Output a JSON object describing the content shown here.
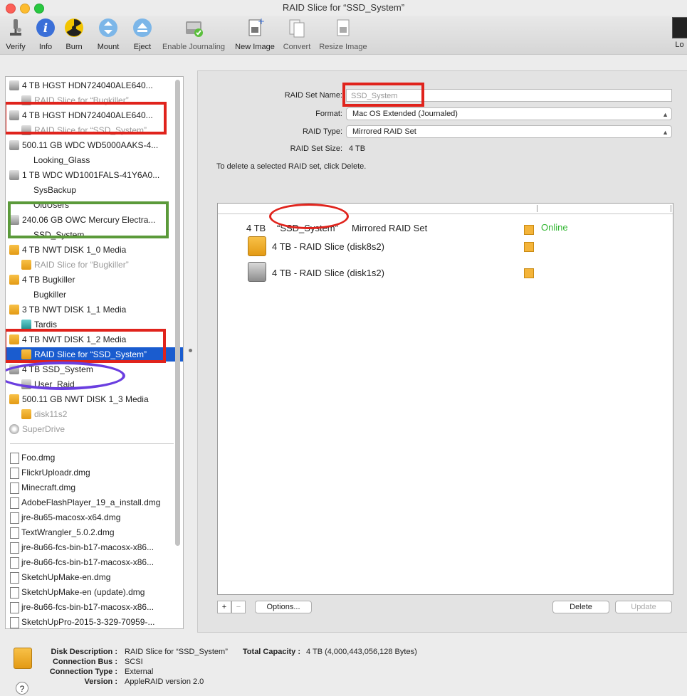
{
  "window": {
    "title": "RAID Slice for “SSD_System”"
  },
  "toolbar": {
    "items": [
      {
        "label": "Verify"
      },
      {
        "label": "Info"
      },
      {
        "label": "Burn"
      },
      {
        "label": "Mount"
      },
      {
        "label": "Eject"
      },
      {
        "label": "Enable Journaling"
      },
      {
        "label": "New Image"
      },
      {
        "label": "Convert"
      },
      {
        "label": "Resize Image"
      }
    ],
    "log_label": "Lo"
  },
  "sidebar": {
    "items": [
      {
        "label": "4 TB HGST HDN724040ALE640..."
      },
      {
        "label": "RAID Slice for “Bugkiller”"
      },
      {
        "label": "4 TB HGST HDN724040ALE640..."
      },
      {
        "label": "RAID Slice for “SSD_System”"
      },
      {
        "label": "500.11 GB WDC WD5000AAKS-4..."
      },
      {
        "label": "Looking_Glass"
      },
      {
        "label": "1 TB WDC WD1001FALS-41Y6A0..."
      },
      {
        "label": "SysBackup"
      },
      {
        "label": "OldUsers"
      },
      {
        "label": "240.06 GB OWC Mercury Electra..."
      },
      {
        "label": "SSD_System"
      },
      {
        "label": "4 TB NWT DISK 1_0 Media"
      },
      {
        "label": "RAID Slice for “Bugkiller”"
      },
      {
        "label": "4 TB Bugkiller"
      },
      {
        "label": "Bugkiller"
      },
      {
        "label": "3 TB NWT DISK 1_1 Media"
      },
      {
        "label": "Tardis"
      },
      {
        "label": "4 TB NWT DISK 1_2 Media"
      },
      {
        "label": "RAID Slice for “SSD_System”"
      },
      {
        "label": "4 TB SSD_System"
      },
      {
        "label": "User_Raid"
      },
      {
        "label": "500.11 GB NWT DISK 1_3 Media"
      },
      {
        "label": "disk11s2"
      },
      {
        "label": "SuperDrive"
      }
    ],
    "images": [
      {
        "label": "Foo.dmg"
      },
      {
        "label": "FlickrUploadr.dmg"
      },
      {
        "label": "Minecraft.dmg"
      },
      {
        "label": "AdobeFlashPlayer_19_a_install.dmg"
      },
      {
        "label": "jre-8u65-macosx-x64.dmg"
      },
      {
        "label": "TextWrangler_5.0.2.dmg"
      },
      {
        "label": "jre-8u66-fcs-bin-b17-macosx-x86..."
      },
      {
        "label": "jre-8u66-fcs-bin-b17-macosx-x86..."
      },
      {
        "label": "SketchUpMake-en.dmg"
      },
      {
        "label": "SketchUpMake-en (update).dmg"
      },
      {
        "label": "jre-8u66-fcs-bin-b17-macosx-x86..."
      },
      {
        "label": "SketchUpPro-2015-3-329-70959-..."
      }
    ]
  },
  "form": {
    "name_label": "RAID Set Name:",
    "name_value": "SSD_System",
    "format_label": "Format:",
    "format_value": "Mac OS Extended (Journaled)",
    "type_label": "RAID Type:",
    "type_value": "Mirrored RAID Set",
    "size_label": "RAID Set Size:",
    "size_value": "4 TB",
    "hint": "To delete a selected RAID set, click Delete."
  },
  "raid": {
    "set_size": "4 TB",
    "set_name": "“SSD_System”",
    "set_type": "Mirrored RAID Set",
    "status": "Online",
    "slices": [
      {
        "label": "4 TB - RAID Slice (disk8s2)"
      },
      {
        "label": "4 TB - RAID Slice (disk1s2)"
      }
    ]
  },
  "buttons": {
    "add": "+",
    "remove": "−",
    "options": "Options...",
    "delete": "Delete",
    "update": "Update"
  },
  "info": {
    "desc_label": "Disk Description :",
    "desc_value": "RAID Slice for “SSD_System”",
    "cap_label": "Total Capacity :",
    "cap_value": "4 TB (4,000,443,056,128 Bytes)",
    "bus_label": "Connection Bus :",
    "bus_value": "SCSI",
    "type_label": "Connection Type :",
    "type_value": "External",
    "ver_label": "Version :",
    "ver_value": "AppleRAID version 2.0",
    "help": "?"
  },
  "colors": {
    "accent": "#1a5ccf",
    "annot_red": "#e0231c",
    "annot_green": "#5b9a3a",
    "annot_purple": "#6a3ee0",
    "online": "#2fb52f"
  }
}
